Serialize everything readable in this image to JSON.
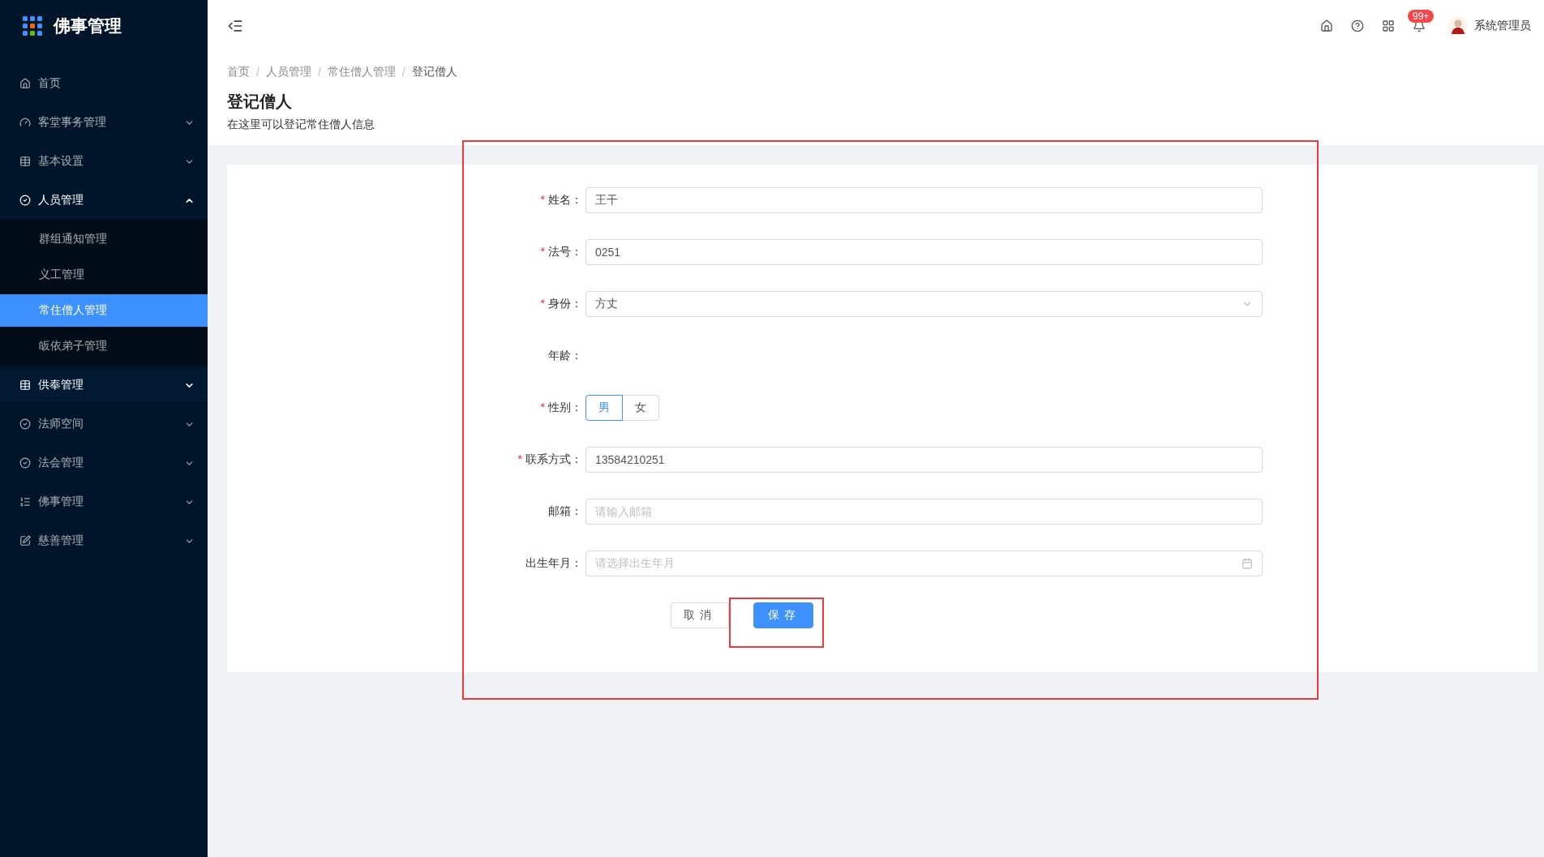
{
  "sidebar": {
    "logo": "佛事管理",
    "items": [
      {
        "label": "首页",
        "expandable": false,
        "expanded": false,
        "hovered": false
      },
      {
        "label": "客堂事务管理",
        "expandable": true,
        "expanded": false,
        "hovered": false
      },
      {
        "label": "基本设置",
        "expandable": true,
        "expanded": false,
        "hovered": false
      },
      {
        "label": "人员管理",
        "expandable": true,
        "expanded": true,
        "hovered": false,
        "children": [
          {
            "label": "群组通知管理",
            "selected": false
          },
          {
            "label": "义工管理",
            "selected": false
          },
          {
            "label": "常住僧人管理",
            "selected": true
          },
          {
            "label": "皈依弟子管理",
            "selected": false
          }
        ]
      },
      {
        "label": "供奉管理",
        "expandable": true,
        "expanded": false,
        "hovered": true
      },
      {
        "label": "法师空间",
        "expandable": true,
        "expanded": false,
        "hovered": false
      },
      {
        "label": "法会管理",
        "expandable": true,
        "expanded": false,
        "hovered": false
      },
      {
        "label": "佛事管理",
        "expandable": true,
        "expanded": false,
        "hovered": false
      },
      {
        "label": "慈善管理",
        "expandable": true,
        "expanded": false,
        "hovered": false
      }
    ]
  },
  "header": {
    "badge": "99+",
    "user": "系统管理员"
  },
  "breadcrumb": [
    {
      "label": "首页"
    },
    {
      "separator": "/",
      "label": "人员管理"
    },
    {
      "separator": "/",
      "label": "常住僧人管理"
    },
    {
      "separator": "/",
      "label": "登记僧人"
    }
  ],
  "title": "登记僧人",
  "subtitle": "在这里可以登记常住僧人信息",
  "form": {
    "fields": [
      {
        "label": "姓名：",
        "required_mark": "*",
        "kind": "text",
        "value": "王干"
      },
      {
        "label": "法号：",
        "required_mark": "*",
        "kind": "text",
        "value": "0251"
      },
      {
        "label": "身份：",
        "required_mark": "*",
        "kind": "select",
        "value": "方丈"
      },
      {
        "label": "年龄：",
        "kind": "empty"
      },
      {
        "label": "性别：",
        "required_mark": "*",
        "kind": "segmented",
        "options": [
          {
            "label": "男",
            "selected": true
          },
          {
            "label": "女",
            "selected": false
          }
        ]
      },
      {
        "label": "联系方式：",
        "required_mark": "*",
        "kind": "text",
        "value": "13584210251"
      },
      {
        "label": "邮箱：",
        "kind": "text",
        "placeholder": "请输入邮箱"
      },
      {
        "label": "出生年月：",
        "kind": "date",
        "placeholder": "请选择出生年月"
      }
    ],
    "buttons": [
      {
        "label": "取消",
        "kind": "default"
      },
      {
        "label": "保存",
        "kind": "primary"
      }
    ]
  }
}
